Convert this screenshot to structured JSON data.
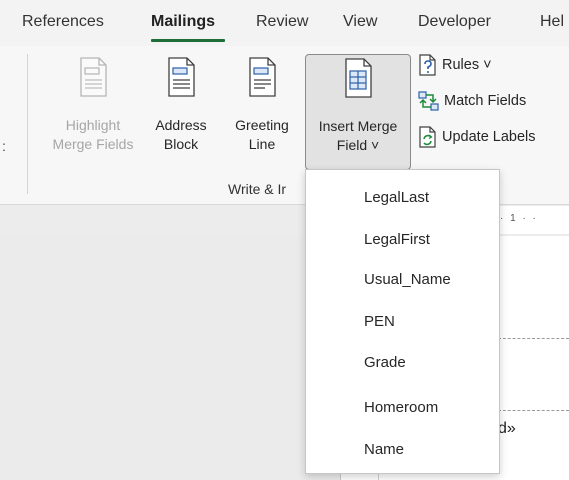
{
  "tabs": [
    {
      "label": "References",
      "active": false
    },
    {
      "label": "Mailings",
      "active": true
    },
    {
      "label": "Review",
      "active": false
    },
    {
      "label": "View",
      "active": false
    },
    {
      "label": "Developer",
      "active": false
    },
    {
      "label": "Hel",
      "active": false
    }
  ],
  "ribbon": {
    "left_fragment": ":",
    "highlight": {
      "line1": "Highlight",
      "line2": "Merge Fields",
      "disabled": true
    },
    "address": {
      "line1": "Address",
      "line2": "Block"
    },
    "greeting": {
      "line1": "Greeting",
      "line2": "Line"
    },
    "insert": {
      "line1": "Insert Merge",
      "line2": "Field ˅"
    },
    "rules": "Rules ˅",
    "match_fields": "Match Fields",
    "update_labels": "Update Labels",
    "group_label": "Write & Ir"
  },
  "ruler": {
    "marks": "· 1 · ·"
  },
  "document": {
    "merge_fragment": "d»"
  },
  "dropdown": {
    "items": [
      "LegalLast",
      "LegalFirst",
      "Usual_Name",
      "PEN",
      "Grade",
      "Homeroom",
      "Name"
    ]
  },
  "colors": {
    "accent": "#1e6e3a",
    "icon_blue": "#2b5fa8"
  }
}
